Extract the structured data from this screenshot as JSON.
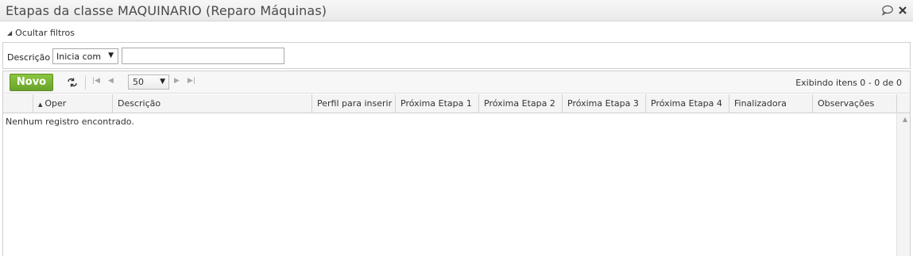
{
  "window": {
    "title": "Etapas da classe MAQUINARIO (Reparo Máquinas)",
    "comment_icon": "speech-bubble-icon",
    "close_symbol": "×"
  },
  "filters": {
    "toggle_label": "Ocultar filtros",
    "field_label": "Descrição",
    "operator_selected": "Inicia com",
    "value": ""
  },
  "toolbar": {
    "new_label": "Novo",
    "page_size": "50",
    "status_text": "Exibindo itens 0 - 0 de 0"
  },
  "table": {
    "columns": [
      {
        "label": ""
      },
      {
        "label": "Oper",
        "sorted": "asc"
      },
      {
        "label": "Descrição"
      },
      {
        "label": "Perfil para inserir"
      },
      {
        "label": "Próxima Etapa 1"
      },
      {
        "label": "Próxima Etapa 2"
      },
      {
        "label": "Próxima Etapa 3"
      },
      {
        "label": "Próxima Etapa 4"
      },
      {
        "label": "Finalizadora"
      },
      {
        "label": "Observações"
      }
    ],
    "empty_message": "Nenhum registro encontrado."
  },
  "colors": {
    "new_button": "#7ab434",
    "header_bg": "#f4f4f4",
    "title_bg": "#efefef"
  }
}
